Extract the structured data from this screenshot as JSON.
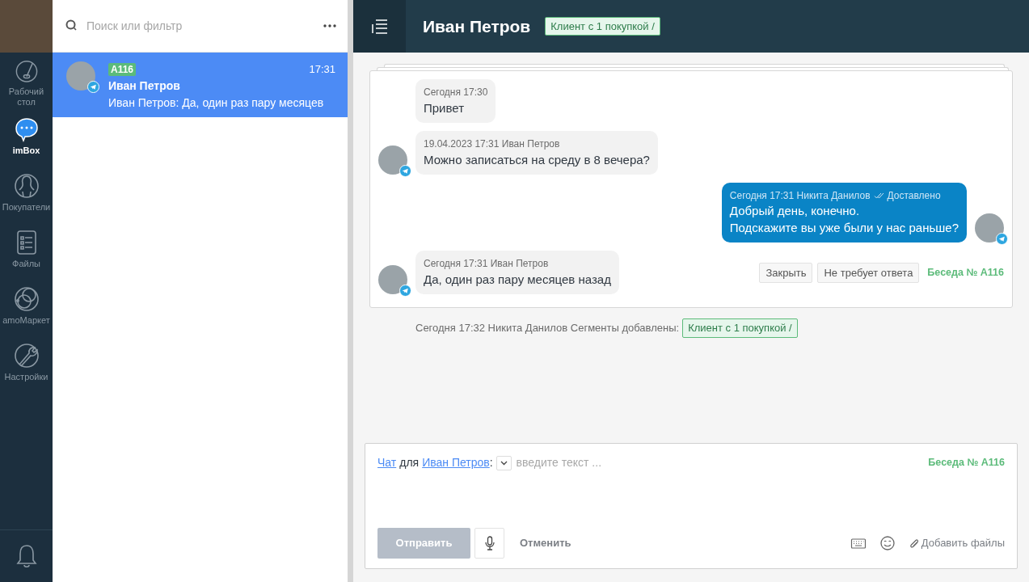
{
  "sidebar": {
    "items": [
      {
        "kind": "dashboard",
        "label": "Рабочий стол",
        "selected": false
      },
      {
        "kind": "chat",
        "label": "imBox",
        "selected": true
      },
      {
        "kind": "people",
        "label": "Покупатели",
        "selected": false
      },
      {
        "kind": "files",
        "label": "Файлы",
        "selected": false
      },
      {
        "kind": "market",
        "label": "amoМаркет",
        "selected": false
      },
      {
        "kind": "settings",
        "label": "Настройки",
        "selected": false
      }
    ]
  },
  "chat_list": {
    "search": {
      "placeholder": "Поиск или фильтр"
    },
    "items": [
      {
        "tag": "A116",
        "time": "17:31",
        "name": "Иван Петров",
        "preview": "Иван Петров: Да, один раз пару месяцев",
        "selected": true
      }
    ]
  },
  "header": {
    "title": "Иван Петров",
    "segment": "Клиент с 1 покупкой /"
  },
  "messages": [
    {
      "kind": "incoming",
      "show_avatar": false,
      "meta": "Сегодня 17:30",
      "lines": [
        "Привет"
      ]
    },
    {
      "kind": "incoming",
      "show_avatar": true,
      "meta": "19.04.2023 17:31 Иван Петров",
      "lines": [
        "Можно записаться на среду в 8 вечера?"
      ]
    },
    {
      "kind": "outgoing",
      "show_avatar": true,
      "meta": "Сегодня 17:31 Никита Данилов",
      "status": "Доставлено",
      "lines": [
        "Добрый день, конечно.",
        "Подскажите вы уже были у нас раньше?"
      ]
    },
    {
      "kind": "incoming",
      "show_avatar": true,
      "meta": "Сегодня 17:31 Иван Петров",
      "lines": [
        "Да, один раз пару месяцев назад"
      ]
    }
  ],
  "conversation": {
    "buttons": [
      "Закрыть",
      "Не требует ответа"
    ],
    "label": "Беседа № A116"
  },
  "event": {
    "text": "Сегодня 17:32 Никита Данилов Сегменты добавлены:",
    "segment": "Клиент с 1 покупкой /"
  },
  "composer": {
    "channel": "Чат",
    "preposition": "для",
    "contact": "Иван Петров",
    "separator": ":",
    "placeholder": "введите текст ...",
    "conversation": "Беседа № A116",
    "send": {
      "label": "Отправить",
      "disabled": true
    },
    "cancel": "Отменить",
    "attach": "Добавить файлы"
  }
}
